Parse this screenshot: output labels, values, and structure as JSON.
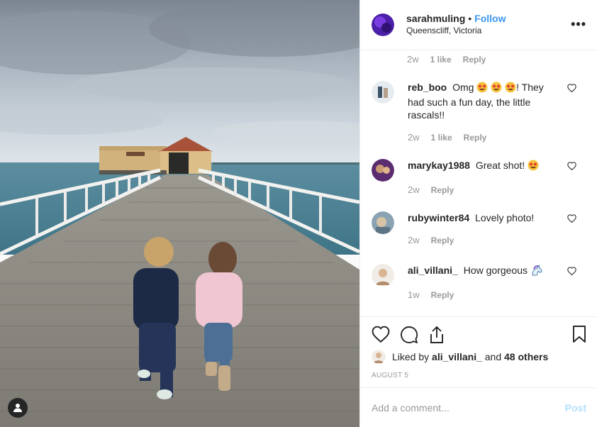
{
  "post": {
    "username": "sarahmuling",
    "separator": "•",
    "follow_label": "Follow",
    "location": "Queenscliff, Victoria",
    "more_label": "•••"
  },
  "top_partial": {
    "time": "2w",
    "likes": "1 like",
    "reply": "Reply"
  },
  "comments": [
    {
      "user": "reb_boo",
      "text_before": "Omg",
      "emoji_count": 3,
      "text_after": "! They had such a fun day, the little rascals!!",
      "time": "2w",
      "likes": "1 like",
      "reply": "Reply"
    },
    {
      "user": "marykay1988",
      "text_before": "Great shot!",
      "emoji_count": 1,
      "text_after": "",
      "time": "2w",
      "reply": "Reply"
    },
    {
      "user": "rubywinter84",
      "text_before": "Lovely photo!",
      "time": "2w",
      "reply": "Reply"
    },
    {
      "user": "ali_villani_",
      "text_before": "How gorgeous",
      "time": "1w",
      "reply": "Reply"
    }
  ],
  "likes_summary": {
    "prefix": "Liked by",
    "user": "ali_villani_",
    "middle": "and",
    "others": "48 others"
  },
  "date": "AUGUST 5",
  "add_comment": {
    "placeholder": "Add a comment...",
    "post_label": "Post"
  },
  "icons": {
    "heart": "heart-icon",
    "comment": "comment-icon",
    "share": "share-icon",
    "save": "bookmark-icon",
    "tag": "user-tag-icon",
    "grin": "star-struck-emoji-icon",
    "unicorn": "unicorn-emoji-icon"
  },
  "colors": {
    "link": "#3897f0",
    "muted": "#999999",
    "border": "#efefef",
    "post_disabled": "#b2dffc"
  }
}
